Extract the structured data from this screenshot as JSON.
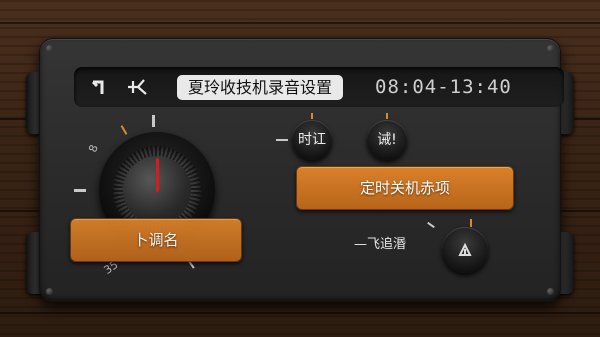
{
  "display": {
    "icon_left": "flag-icon",
    "icon_right": "antenna-icon",
    "title": "夏玲收技机录音设置",
    "clock": "08:04-13:40"
  },
  "dial": {
    "label_top": "8",
    "label_bottom": "35"
  },
  "buttons": {
    "time_button": "时讧",
    "confirm_button": "诫!",
    "shutdown_option": "定时关机赤项",
    "tune_button": "卜调名",
    "flight_label": "—飞追湣"
  },
  "colors": {
    "accent": "#d9812a",
    "needle": "#d61c1c"
  }
}
